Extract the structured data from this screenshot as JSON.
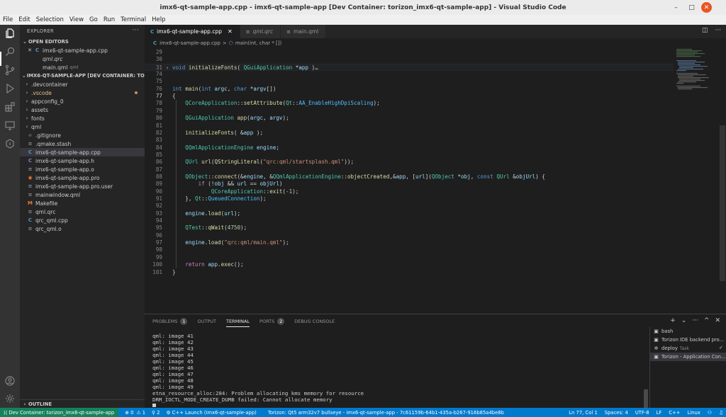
{
  "window": {
    "title": "imx6-qt-sample-app.cpp - imx6-qt-sample-app [Dev Container: torizon_imx6-qt-sample-app] - Visual Studio Code",
    "minimize_glyph": "–",
    "maximize_glyph": "□",
    "close_glyph": "✕"
  },
  "menu": [
    "File",
    "Edit",
    "Selection",
    "View",
    "Go",
    "Run",
    "Terminal",
    "Help"
  ],
  "activity_bar": [
    "files-icon",
    "search-icon",
    "source-control-icon",
    "run-debug-icon",
    "extensions-icon",
    "remote-explorer-icon",
    "torizon-icon",
    "account-icon",
    "settings-icon"
  ],
  "explorer": {
    "header": "EXPLORER",
    "more": "···",
    "open_editors_label": "OPEN EDITORS",
    "open_editors": [
      {
        "name": "imx6-qt-sample-app.cpp",
        "icon": "C",
        "icon_color": "#519aba",
        "sub": "",
        "selected": false,
        "close": "✕"
      },
      {
        "name": "qml.qrc",
        "icon": "",
        "icon_color": "#cccccc",
        "sub": "",
        "italic": true
      },
      {
        "name": "main.qml",
        "icon": "",
        "icon_color": "#cccccc",
        "sub": "qml"
      }
    ],
    "project_label": "IMX6-QT-SAMPLE-APP [DEV CONTAINER: TORIZON_IM...",
    "tree": [
      {
        "name": ".devcontainer",
        "folder": true
      },
      {
        "name": ".vscode",
        "folder": true,
        "color": "#e2c08d",
        "modified": true
      },
      {
        "name": "appconfig_0",
        "folder": true
      },
      {
        "name": "assets",
        "folder": true
      },
      {
        "name": "fonts",
        "folder": true
      },
      {
        "name": "qml",
        "folder": true
      },
      {
        "name": ".gitignore",
        "icon": "◆",
        "icon_color": "#41535b"
      },
      {
        "name": ".qmake.stash",
        "icon": "≡",
        "icon_color": "#8c8c8c"
      },
      {
        "name": "imx6-qt-sample-app.cpp",
        "icon": "C",
        "icon_color": "#519aba",
        "selected": true
      },
      {
        "name": "imx6-qt-sample-app.h",
        "icon": "C",
        "icon_color": "#a074c4"
      },
      {
        "name": "imx6-qt-sample-app.o",
        "icon": "≡",
        "icon_color": "#8c8c8c"
      },
      {
        "name": "imx6-qt-sample-app.pro",
        "icon": "◉",
        "icon_color": "#e37933"
      },
      {
        "name": "imx6-qt-sample-app.pro.user",
        "icon": "≡",
        "icon_color": "#8c8c8c"
      },
      {
        "name": "mainwindow.qml",
        "icon": "≡",
        "icon_color": "#8c8c8c"
      },
      {
        "name": "Makefile",
        "icon": "M",
        "icon_color": "#e37933"
      },
      {
        "name": "qml.qrc",
        "icon": "≡",
        "icon_color": "#8c8c8c"
      },
      {
        "name": "qrc_qml.cpp",
        "icon": "C",
        "icon_color": "#519aba"
      },
      {
        "name": "qrc_qml.o",
        "icon": "≡",
        "icon_color": "#8c8c8c"
      }
    ],
    "outline_label": "OUTLINE"
  },
  "tabs": [
    {
      "name": "imx6-qt-sample-app.cpp",
      "icon": "C",
      "icon_color": "#519aba",
      "active": true,
      "close": "✕"
    },
    {
      "name": "qml.qrc",
      "icon": "≡",
      "icon_color": "#8c8c8c",
      "italic": true
    },
    {
      "name": "main.qml",
      "icon": "≡",
      "icon_color": "#8c8c8c"
    }
  ],
  "tab_actions": [
    "split-editor-icon",
    "more-actions-icon"
  ],
  "breadcrumb": {
    "file": "imx6-qt-sample-app.cpp",
    "sep": ">",
    "symbol": "main(int, char * [])"
  },
  "code": [
    {
      "ln": "29",
      "html": ""
    },
    {
      "ln": "30",
      "html": ""
    },
    {
      "ln": "31",
      "html": "<span class=\"k\">void</span> <span class=\"f\">initializeFonts</span>( <span class=\"t\">QGuiApplication</span> *<span class=\"v\">app</span> )…",
      "fold": true,
      "hl": true
    },
    {
      "ln": "74",
      "html": ""
    },
    {
      "ln": "75",
      "html": ""
    },
    {
      "ln": "76",
      "html": "<span class=\"k\">int</span> <span class=\"f\">main</span>(<span class=\"k\">int</span> <span class=\"v\">argc</span>, <span class=\"k\">char</span> *<span class=\"v\">argv</span>[])"
    },
    {
      "ln": "77",
      "html": "{",
      "cur": true
    },
    {
      "ln": "78",
      "html": "    <span class=\"t\">QCoreApplication</span>::<span class=\"f\">setAttribute</span>(<span class=\"t\">Qt</span>::<span class=\"e\">AA_EnableHighDpiScaling</span>);"
    },
    {
      "ln": "79",
      "html": ""
    },
    {
      "ln": "80",
      "html": "    <span class=\"t\">QGuiApplication</span> <span class=\"f\">app</span>(<span class=\"v\">argc</span>, <span class=\"v\">argv</span>);"
    },
    {
      "ln": "81",
      "html": ""
    },
    {
      "ln": "82",
      "html": "    <span class=\"f\">initializeFonts</span>( &amp;<span class=\"v\">app</span> );"
    },
    {
      "ln": "83",
      "html": ""
    },
    {
      "ln": "84",
      "html": "    <span class=\"t\">QQmlApplicationEngine</span> <span class=\"v\">engine</span>;"
    },
    {
      "ln": "85",
      "html": ""
    },
    {
      "ln": "86",
      "html": "    <span class=\"t\">QUrl</span> <span class=\"f\">url</span>(<span class=\"f\">QStringLiteral</span>(<span class=\"s\">\"qrc:qml/startsplash.qml\"</span>));"
    },
    {
      "ln": "87",
      "html": ""
    },
    {
      "ln": "88",
      "html": "    <span class=\"t\">QObject</span>::<span class=\"f\">connect</span>(&amp;<span class=\"v\">engine</span>, &amp;<span class=\"t\">QQmlApplicationEngine</span>::<span class=\"f\">objectCreated</span>,&amp;<span class=\"v\">app</span>, [<span class=\"v\">url</span>](<span class=\"t\">QObject</span> *<span class=\"v\">obj</span>, <span class=\"k\">const</span> <span class=\"t\">QUrl</span> &amp;<span class=\"v\">objUrl</span>) {"
    },
    {
      "ln": "89",
      "html": "        <span class=\"c\">if</span> (!<span class=\"v\">obj</span> &amp;&amp; <span class=\"v\">url</span> == <span class=\"v\">objUrl</span>)"
    },
    {
      "ln": "90",
      "html": "            <span class=\"t\">QCoreApplication</span>::<span class=\"f\">exit</span>(-<span class=\"n\">1</span>);"
    },
    {
      "ln": "91",
      "html": "    }, <span class=\"t\">Qt</span>::<span class=\"e\">QueuedConnection</span>);"
    },
    {
      "ln": "92",
      "html": ""
    },
    {
      "ln": "93",
      "html": "    <span class=\"v\">engine</span>.<span class=\"f\">load</span>(<span class=\"v\">url</span>);"
    },
    {
      "ln": "94",
      "html": ""
    },
    {
      "ln": "95",
      "html": "    <span class=\"t\">QTest</span>::<span class=\"f\">qWait</span>(<span class=\"n\">4750</span>);"
    },
    {
      "ln": "96",
      "html": ""
    },
    {
      "ln": "97",
      "html": "    <span class=\"v\">engine</span>.<span class=\"f\">load</span>(<span class=\"s\">\"qrc:qml/main.qml\"</span>);"
    },
    {
      "ln": "98",
      "html": ""
    },
    {
      "ln": "99",
      "html": ""
    },
    {
      "ln": "100",
      "html": "    <span class=\"c\">return</span> <span class=\"v\">app</span>.<span class=\"f\">exec</span>();"
    },
    {
      "ln": "101",
      "html": "}"
    }
  ],
  "panel": {
    "tabs": [
      {
        "label": "PROBLEMS",
        "badge": "1"
      },
      {
        "label": "OUTPUT",
        "badge": ""
      },
      {
        "label": "TERMINAL",
        "badge": "",
        "active": true
      },
      {
        "label": "PORTS",
        "badge": "2"
      },
      {
        "label": "DEBUG CONSOLE",
        "badge": ""
      }
    ],
    "actions": [
      "+",
      "⌄",
      "···",
      "^",
      "✕"
    ],
    "terminal_lines": [
      "qml: image 41",
      "qml: image 42",
      "qml: image 43",
      "qml: image 44",
      "qml: image 45",
      "qml: image 46",
      "qml: image 47",
      "qml: image 48",
      "qml: image 49",
      "etna_resource_alloc:284: Problem allocating kms memory for resource",
      "DRM_IOCTL_MODE_CREATE_DUMB failed: Cannot allocate memory"
    ],
    "terminals": [
      {
        "name": "bash",
        "icon": "▣"
      },
      {
        "name": "Torizon IDE backend pro...",
        "icon": "▣"
      },
      {
        "name": "deploy",
        "sub": "Task",
        "icon": "✲",
        "check": "✓"
      },
      {
        "name": "Torizon - Application Con...",
        "icon": "▣",
        "selected": true
      }
    ]
  },
  "statusbar": {
    "remote": "⟩⟨ Dev Container: torizon_imx6-qt-sample-app",
    "errors": "⊗ 0",
    "warnings": "⚠ 1",
    "ports": "⚲ 2",
    "launch": "⚙ C++ Launch (imx6-qt-sample-app)",
    "torizon": "Torizon: Qt5 arm32v7 bullseye - imx6-qt-sample-app - 7c61159b-64b1-435a-b267-916b85a4be8b",
    "position": "Ln 77, Col 1",
    "spaces": "Spaces: 4",
    "encoding": "UTF-8",
    "eol": "LF",
    "language": "C++",
    "os": "Linux",
    "feedback": "⚇",
    "bell": "♫"
  }
}
